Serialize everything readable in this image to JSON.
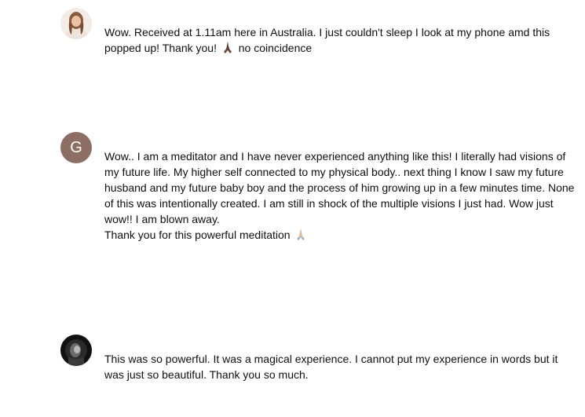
{
  "comments": [
    {
      "avatar": {
        "kind": "photo",
        "description_icon": "woman-portrait-avatar"
      },
      "lines": [
        "Wow. Received at 1.11am here in Australia. I just couldn't sleep I look at my phone amd this",
        "popped up! Thank you!",
        "no coincidence"
      ],
      "emoji": "praying-hands-medium-dark"
    },
    {
      "avatar": {
        "kind": "letter",
        "letter": "G",
        "color": "#8d6e63"
      },
      "lines": [
        "Wow.. I am a meditator and I have never experienced anything like this! I literally had visions of",
        "my future life. My higher self connected to my physical body.. next thing I know I saw my future",
        "husband and my future baby boy and the process of him growing up in a few minutes time. None",
        "of this was intentionally created. I am still in shock of the multiple visions I just had. Wow just",
        "wow!! I am blown away.",
        "Thank you for this powerful meditation"
      ],
      "emoji": "praying-hands-light"
    },
    {
      "avatar": {
        "kind": "photo",
        "description_icon": "dark-photo-avatar"
      },
      "lines": [
        "This was so powerful. It was a magical experience. I cannot put my experience in words but it",
        "was just so beautiful. Thank you so much."
      ]
    }
  ],
  "colors": {
    "text": "#0f0f0f",
    "letter_avatar_bg": "#8d6e63",
    "emoji_dark": "#6b4a3a",
    "emoji_light": "#e8c4a0"
  }
}
